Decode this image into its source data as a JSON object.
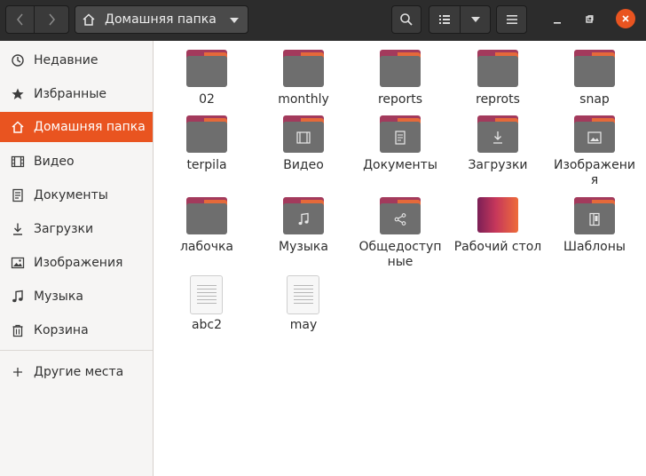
{
  "header": {
    "location_label": "Домашняя папка",
    "icons": {
      "back": "chevron-left-icon",
      "forward": "chevron-right-icon",
      "home": "home-icon",
      "location_menu": "chevron-down-icon",
      "search": "search-icon",
      "view_list": "list-view-icon",
      "view_options": "chevron-down-icon",
      "menu": "hamburger-menu-icon",
      "minimize": "minimize-icon",
      "maximize": "maximize-icon",
      "close": "close-icon"
    },
    "close_color": "#e95420"
  },
  "sidebar": {
    "items": [
      {
        "label": "Недавние",
        "icon": "recent-icon"
      },
      {
        "label": "Избранные",
        "icon": "star-icon"
      },
      {
        "label": "Домашняя папка",
        "icon": "home-icon",
        "active": true
      },
      {
        "label": "Видео",
        "icon": "video-icon"
      },
      {
        "label": "Документы",
        "icon": "document-icon"
      },
      {
        "label": "Загрузки",
        "icon": "download-icon"
      },
      {
        "label": "Изображения",
        "icon": "image-icon"
      },
      {
        "label": "Музыка",
        "icon": "music-icon"
      },
      {
        "label": "Корзина",
        "icon": "trash-icon"
      }
    ],
    "other_places": {
      "label": "Другие места",
      "icon": "plus-icon"
    },
    "accent_color": "#e95420"
  },
  "files": [
    {
      "label": "02",
      "icon": "folder-icon"
    },
    {
      "label": "monthly",
      "icon": "folder-icon"
    },
    {
      "label": "reports",
      "icon": "folder-icon"
    },
    {
      "label": "reprots",
      "icon": "folder-icon"
    },
    {
      "label": "snap",
      "icon": "folder-icon"
    },
    {
      "label": "terpila",
      "icon": "folder-icon"
    },
    {
      "label": "Видео",
      "icon": "folder-video-icon"
    },
    {
      "label": "Документы",
      "icon": "folder-documents-icon"
    },
    {
      "label": "Загрузки",
      "icon": "folder-download-icon"
    },
    {
      "label": "Изображения",
      "icon": "folder-pictures-icon"
    },
    {
      "label": "лабочка",
      "icon": "folder-icon"
    },
    {
      "label": "Музыка",
      "icon": "folder-music-icon"
    },
    {
      "label": "Общедоступные",
      "icon": "folder-public-icon"
    },
    {
      "label": "Рабочий стол",
      "icon": "folder-desktop-icon"
    },
    {
      "label": "Шаблоны",
      "icon": "folder-templates-icon"
    },
    {
      "label": "abc2",
      "icon": "text-file-icon"
    },
    {
      "label": "may",
      "icon": "text-file-icon"
    }
  ]
}
